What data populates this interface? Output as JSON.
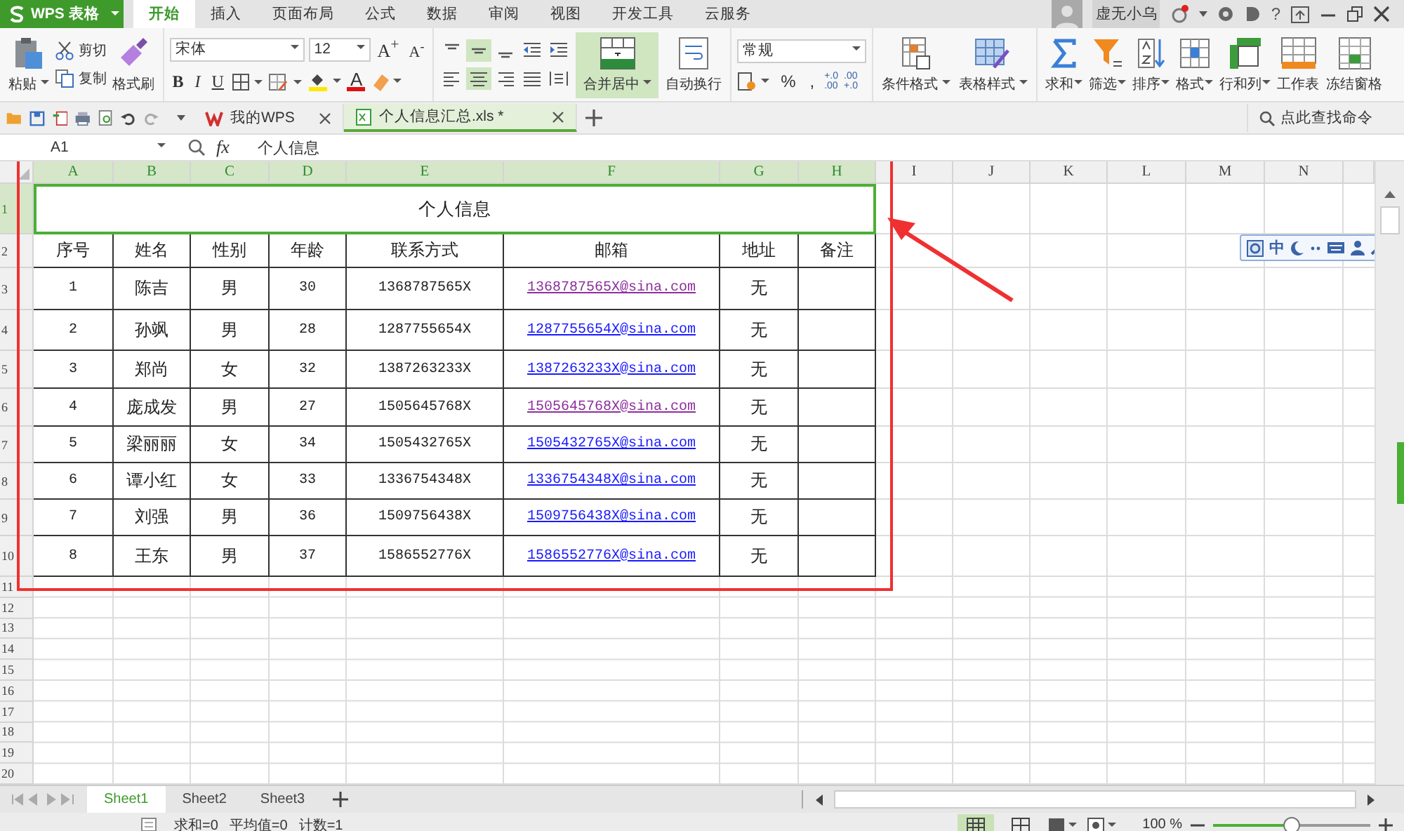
{
  "app_button": {
    "label": "WPS 表格"
  },
  "ribbon_tabs": [
    {
      "label": "开始",
      "selected": true
    },
    {
      "label": "插入",
      "selected": false
    },
    {
      "label": "页面布局",
      "selected": false
    },
    {
      "label": "公式",
      "selected": false
    },
    {
      "label": "数据",
      "selected": false
    },
    {
      "label": "审阅",
      "selected": false
    },
    {
      "label": "视图",
      "selected": false
    },
    {
      "label": "开发工具",
      "selected": false
    },
    {
      "label": "云服务",
      "selected": false
    }
  ],
  "account": {
    "name": "虚无小乌",
    "help": "?"
  },
  "ribbon": {
    "clipboard": {
      "paste": "粘贴",
      "cut": "剪切",
      "copy": "复制",
      "format_painter": "格式刷"
    },
    "font": {
      "family": "宋体",
      "size": "12",
      "grow": "A$^{+}$",
      "shrink": "A$^{-}$",
      "bold": "B",
      "italic": "I",
      "underline": "U",
      "font_color_label": "A"
    },
    "alignment": {
      "vertical": [
        {
          "selected": false
        },
        {
          "selected": true
        },
        {
          "selected": false
        }
      ],
      "horizontal": [
        {
          "selected": false
        },
        {
          "selected": true
        },
        {
          "selected": false
        },
        {
          "selected": false
        }
      ],
      "merge": {
        "label": "合并居中",
        "selected": true
      },
      "wrap": "自动换行"
    },
    "number": {
      "format": "常规",
      "percent": "%",
      "thousands": ",",
      "increase_decimal": [
        "+.0",
        ".00"
      ],
      "decrease_decimal": [
        ".00",
        "+.0"
      ]
    },
    "styles": [
      "条件格式",
      "表格样式"
    ],
    "editing": [
      "求和",
      "筛选",
      "排序",
      "格式",
      "行和列",
      "工作表",
      "冻结窗格"
    ]
  },
  "doc_tabs": [
    {
      "label": "我的WPS",
      "selected": false
    },
    {
      "label": "个人信息汇总.xls *",
      "selected": true
    }
  ],
  "command_search": {
    "placeholder": "点此查找命令"
  },
  "formula_bar": {
    "cell_ref": "A1",
    "fx": "fx",
    "value": "个人信息"
  },
  "columns": [
    {
      "label": "A",
      "selected": true
    },
    {
      "label": "B",
      "selected": true
    },
    {
      "label": "C",
      "selected": true
    },
    {
      "label": "D",
      "selected": true
    },
    {
      "label": "E",
      "selected": true
    },
    {
      "label": "F",
      "selected": true
    },
    {
      "label": "G",
      "selected": true
    },
    {
      "label": "H",
      "selected": true
    },
    {
      "label": "I",
      "selected": false
    },
    {
      "label": "J",
      "selected": false
    },
    {
      "label": "K",
      "selected": false
    },
    {
      "label": "L",
      "selected": false
    },
    {
      "label": "M",
      "selected": false
    },
    {
      "label": "N",
      "selected": false
    }
  ],
  "row_headers": [
    {
      "label": "1",
      "selected": true
    },
    {
      "label": "2",
      "selected": false
    },
    {
      "label": "3",
      "selected": false
    },
    {
      "label": "4",
      "selected": false
    },
    {
      "label": "5",
      "selected": false
    },
    {
      "label": "6",
      "selected": false
    },
    {
      "label": "7",
      "selected": false
    },
    {
      "label": "8",
      "selected": false
    },
    {
      "label": "9",
      "selected": false
    },
    {
      "label": "10",
      "selected": false
    },
    {
      "label": "11",
      "selected": false
    },
    {
      "label": "12",
      "selected": false
    },
    {
      "label": "13",
      "selected": false
    },
    {
      "label": "14",
      "selected": false
    },
    {
      "label": "15",
      "selected": false
    },
    {
      "label": "16",
      "selected": false
    },
    {
      "label": "17",
      "selected": false
    },
    {
      "label": "18",
      "selected": false
    },
    {
      "label": "19",
      "selected": false
    },
    {
      "label": "20",
      "selected": false
    }
  ],
  "table": {
    "title": "个人信息",
    "header": [
      "序号",
      "姓名",
      "性别",
      "年龄",
      "联系方式",
      "邮箱",
      "地址",
      "备注"
    ],
    "rows": [
      {
        "cells": [
          "1",
          "陈吉",
          "男",
          "30",
          "1368787565X"
        ],
        "email": {
          "text": "1368787565X@sina.com",
          "visited": true
        },
        "address": "无"
      },
      {
        "cells": [
          "2",
          "孙飒",
          "男",
          "28",
          "1287755654X"
        ],
        "email": {
          "text": "1287755654X@sina.com",
          "visited": false
        },
        "address": "无"
      },
      {
        "cells": [
          "3",
          "郑尚",
          "女",
          "32",
          "1387263233X"
        ],
        "email": {
          "text": "1387263233X@sina.com",
          "visited": false
        },
        "address": "无"
      },
      {
        "cells": [
          "4",
          "庞成发",
          "男",
          "27",
          "1505645768X"
        ],
        "email": {
          "text": "1505645768X@sina.com",
          "visited": true
        },
        "address": "无"
      },
      {
        "cells": [
          "5",
          "梁丽丽",
          "女",
          "34",
          "1505432765X"
        ],
        "email": {
          "text": "1505432765X@sina.com",
          "visited": false
        },
        "address": "无"
      },
      {
        "cells": [
          "6",
          "谭小红",
          "女",
          "33",
          "1336754348X"
        ],
        "email": {
          "text": "1336754348X@sina.com",
          "visited": false
        },
        "address": "无"
      },
      {
        "cells": [
          "7",
          "刘强",
          "男",
          "36",
          "1509756438X"
        ],
        "email": {
          "text": "1509756438X@sina.com",
          "visited": false
        },
        "address": "无"
      },
      {
        "cells": [
          "8",
          "王东",
          "男",
          "37",
          "1586552776X"
        ],
        "email": {
          "text": "1586552776X@sina.com",
          "visited": false
        },
        "address": "无"
      }
    ]
  },
  "ime_toolbar": {
    "mode": "中"
  },
  "sheet_tabs": [
    {
      "label": "Sheet1",
      "selected": true
    },
    {
      "label": "Sheet2",
      "selected": false
    },
    {
      "label": "Sheet3",
      "selected": false
    }
  ],
  "status_bar": {
    "stats": [
      "求和=0",
      "平均值=0",
      "计数=1"
    ],
    "zoom": "100 %",
    "zoom_level": {
      "level": 0.5
    }
  }
}
